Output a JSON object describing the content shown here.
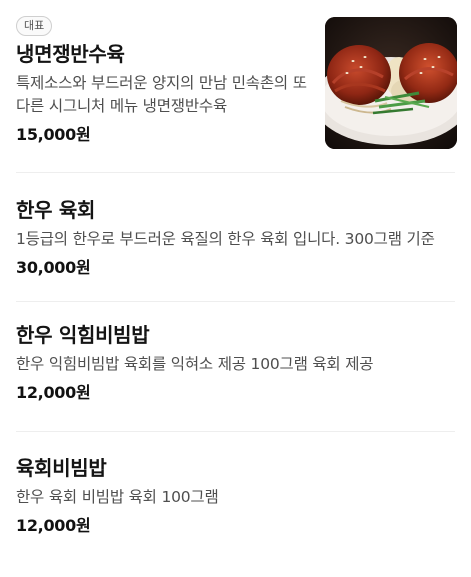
{
  "menu": {
    "items": [
      {
        "badge": "대표",
        "name": "냉면쟁반수육",
        "description": "특제소스와 부드러운 양지의 만남 민속촌의 또다른 시그니처 메뉴 냉면쟁반수육",
        "price": "15,000원",
        "has_image": true
      },
      {
        "name": "한우 육회",
        "description": "1등급의 한우로 부드러운 육질의 한우 육회 입니다. 300그램 기준",
        "price": "30,000원"
      },
      {
        "name": "한우 익힘비빔밥",
        "description": "한우 익힘비빔밥 육회를 익혀소 제공 100그램 육회 제공",
        "price": "12,000원"
      },
      {
        "name": "육회비빔밥",
        "description": "한우 육회 비빔밥 육회 100그램",
        "price": "12,000원"
      }
    ]
  },
  "colors": {
    "name": "#141414",
    "description": "#4f4f4f",
    "divider": "#eeeeee",
    "badge_border": "#cfcfcf"
  }
}
